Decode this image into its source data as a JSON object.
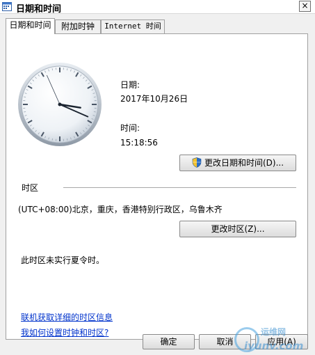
{
  "window": {
    "title": "日期和时间",
    "close_glyph": "×"
  },
  "tabs": [
    {
      "label": "日期和时间",
      "active": true
    },
    {
      "label": "附加时钟",
      "active": false
    },
    {
      "label": "Internet 时间",
      "active": false
    }
  ],
  "clock": {
    "hour": 15,
    "minute": 18,
    "second": 56
  },
  "date": {
    "label": "日期:",
    "value": "2017年10月26日"
  },
  "time": {
    "label": "时间:",
    "value": "15:18:56"
  },
  "buttons": {
    "change_datetime": "更改日期和时间(D)...",
    "change_timezone": "更改时区(Z)...",
    "ok": "确定",
    "cancel": "取消",
    "apply": "应用(A)"
  },
  "timezone": {
    "section_label": "时区",
    "value": "(UTC+08:00)北京，重庆，香港特别行政区，乌鲁木齐",
    "dst_note": "此时区未实行夏令时。"
  },
  "links": {
    "online_tz_info": "联机获取详细的时区信息",
    "how_set_clock": "我如何设置时钟和时区?"
  },
  "watermark": {
    "top": "运维网",
    "bottom": "iyunv.com"
  },
  "colors": {
    "link": "#0033cc",
    "panel": "#ffffff",
    "dialog": "#f0f0f0"
  },
  "icons": {
    "title": "calendar-clock-icon",
    "uac": "uac-shield-icon"
  }
}
